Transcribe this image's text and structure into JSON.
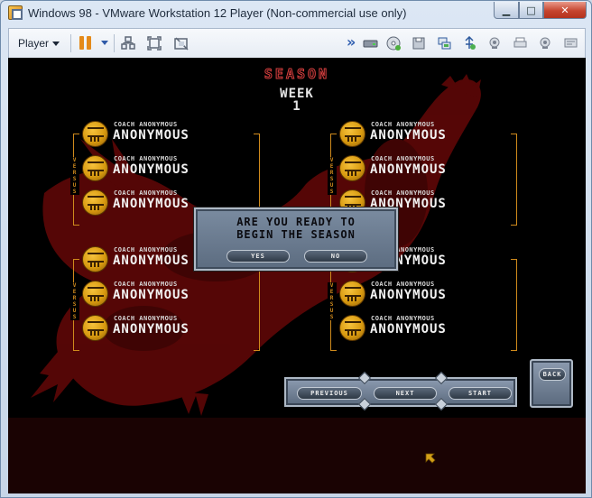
{
  "window": {
    "title": "Windows 98 - VMware Workstation 12 Player (Non-commercial use only)",
    "minimize_glyph": "▁",
    "maximize_glyph": "□",
    "close_glyph": "✕"
  },
  "toolbar": {
    "player_label": "Player",
    "more_glyph": "»"
  },
  "game": {
    "title": "SEASON",
    "week_label": "WEEK",
    "week_number": "1",
    "versus_text": "VERSUS",
    "matches": [
      {
        "teams": [
          {
            "coach": "COACH ANONYMOUS",
            "name": "ANONYMOUS"
          },
          {
            "coach": "COACH ANONYMOUS",
            "name": "ANONYMOUS"
          },
          {
            "coach": "COACH ANONYMOUS",
            "name": "ANONYMOUS"
          }
        ]
      },
      {
        "teams": [
          {
            "coach": "COACH ANONYMOUS",
            "name": "ANONYMOUS"
          },
          {
            "coach": "COACH ANONYMOUS",
            "name": "ANONYMOUS"
          },
          {
            "coach": "COACH ANONYMOUS",
            "name": "ANONYMOUS"
          }
        ]
      },
      {
        "teams": [
          {
            "coach": "COACH ANONYMOUS",
            "name": "ANONYMOUS"
          },
          {
            "coach": "COACH ANONYMOUS",
            "name": "ANONYMOUS"
          },
          {
            "coach": "COACH ANONYMOUS",
            "name": "ANONYMOUS"
          }
        ]
      },
      {
        "teams": [
          {
            "coach": "COACH ANONYMOUS",
            "name": "ANONYMOUS"
          },
          {
            "coach": "COACH ANONYMOUS",
            "name": "ANONYMOUS"
          },
          {
            "coach": "COACH ANONYMOUS",
            "name": "ANONYMOUS"
          }
        ]
      }
    ],
    "dialog": {
      "line1": "ARE YOU READY TO",
      "line2": "BEGIN THE SEASON",
      "yes_label": "YES",
      "no_label": "NO"
    },
    "nav": {
      "previous_label": "PREVIOUS",
      "next_label": "NEXT",
      "start_label": "START",
      "back_label": "BACK"
    }
  },
  "colors": {
    "accent_orange": "#cf8a1c",
    "title_red": "#d84040",
    "panel_steel": "#6b7b90",
    "demon_red": "#6a0a0a"
  }
}
